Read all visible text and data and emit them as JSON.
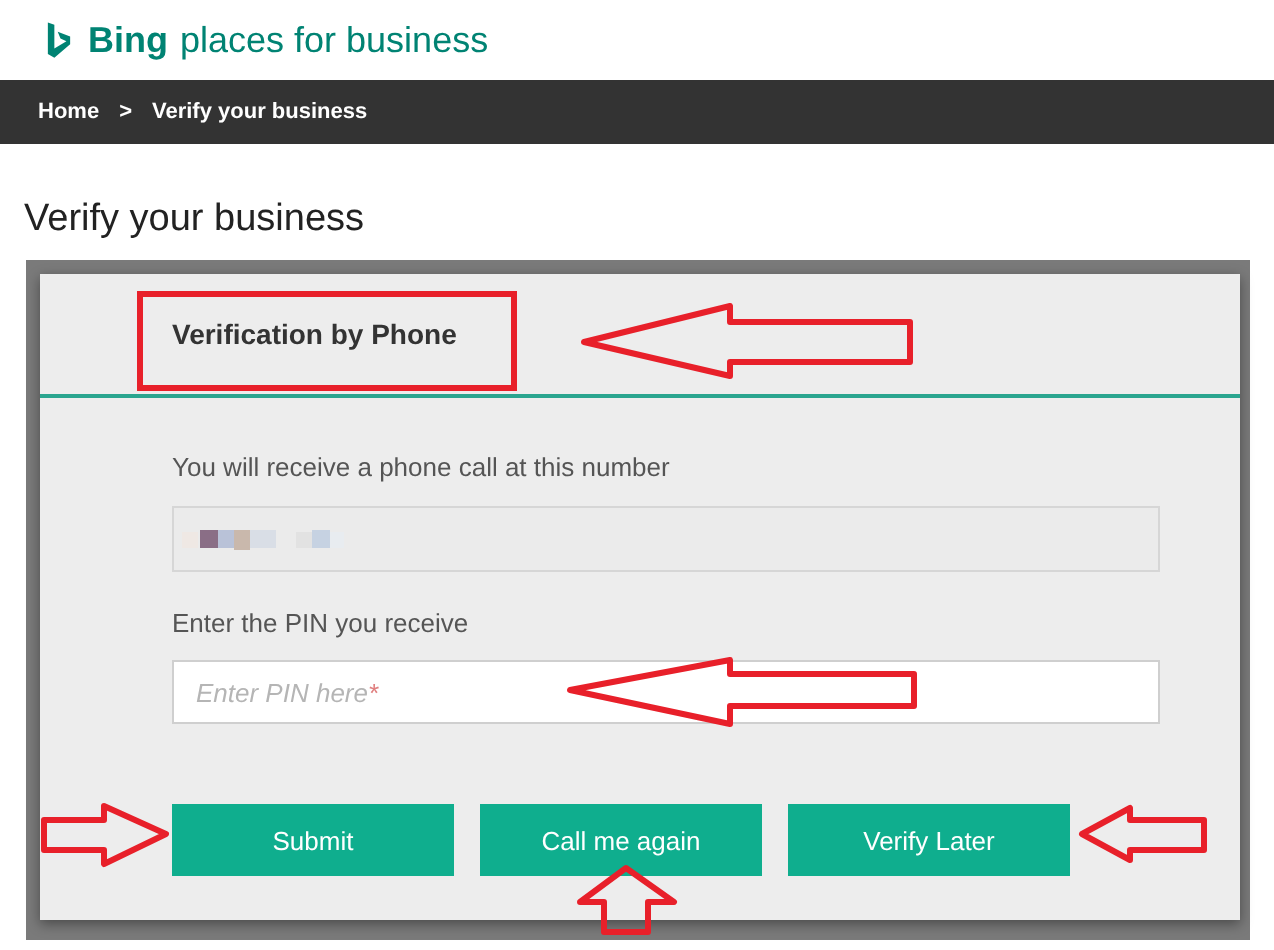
{
  "brand": {
    "name": "Bing",
    "tagline": "places for business"
  },
  "breadcrumb": {
    "items": [
      "Home",
      "Verify your business"
    ],
    "separator": ">"
  },
  "page_title": "Verify your business",
  "dialog": {
    "title": "Verification by Phone",
    "phone_label": "You will receive a phone call at this number",
    "pin_label": "Enter the PIN you receive",
    "pin_field": {
      "placeholder": "Enter PIN here",
      "required_mark": "*"
    },
    "buttons": [
      "Submit",
      "Call me again",
      "Verify Later"
    ]
  }
}
